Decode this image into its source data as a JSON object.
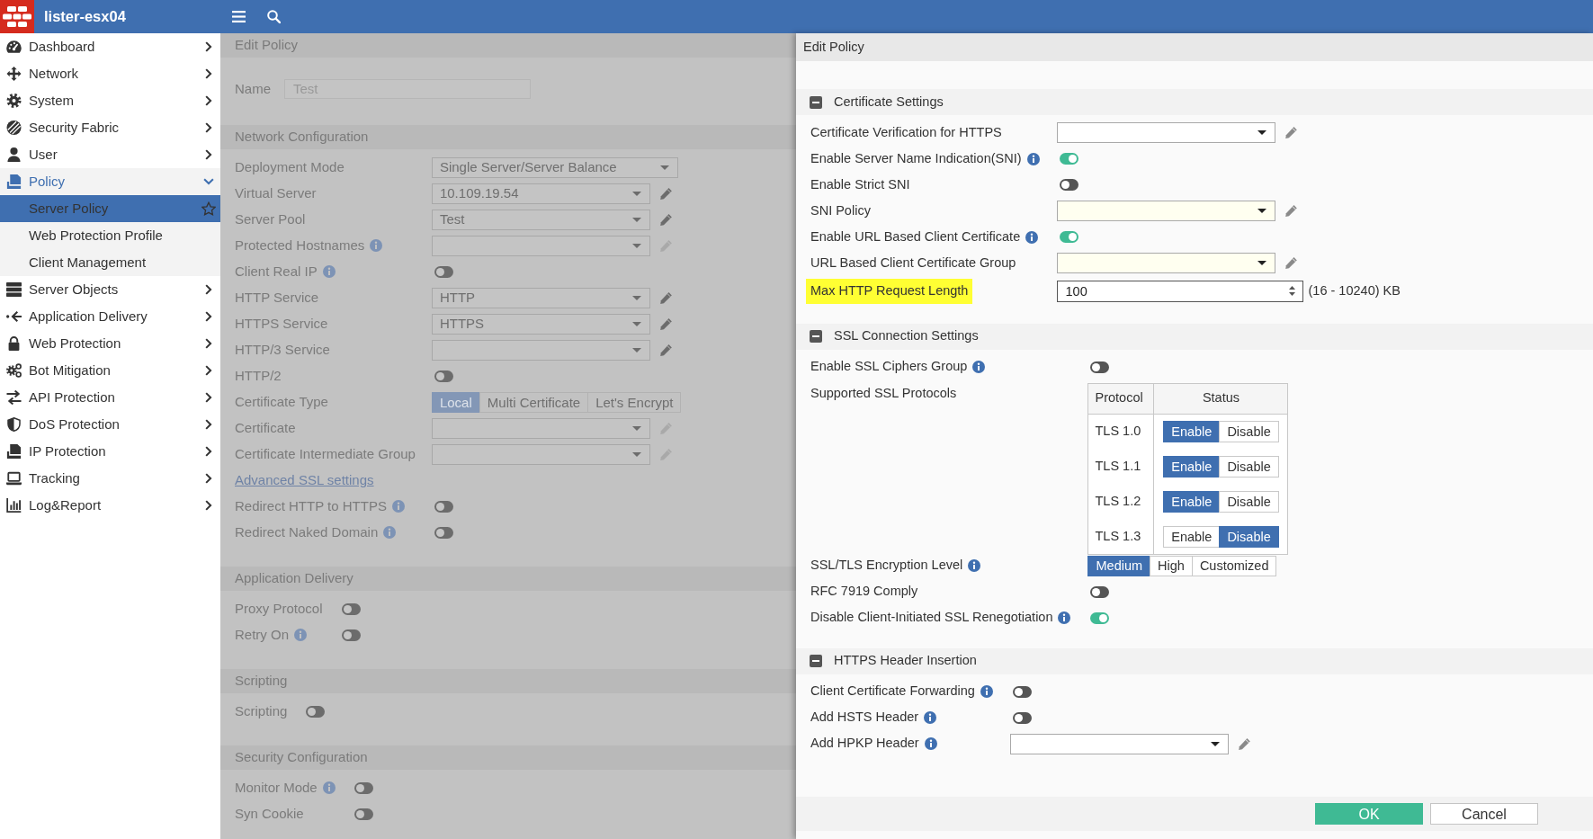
{
  "top_bar": {
    "hostname": "lister-esx04"
  },
  "sidebar": {
    "items": [
      {
        "label": "Dashboard",
        "expanded": false,
        "selected": false
      },
      {
        "label": "Network",
        "expanded": false,
        "selected": false
      },
      {
        "label": "System",
        "expanded": false,
        "selected": false
      },
      {
        "label": "Security Fabric",
        "expanded": false,
        "selected": false
      },
      {
        "label": "User",
        "expanded": false,
        "selected": false
      },
      {
        "label": "Policy",
        "expanded": true,
        "selected": false,
        "children": [
          {
            "label": "Server Policy",
            "selected": true
          },
          {
            "label": "Web Protection Profile",
            "selected": false
          },
          {
            "label": "Client Management",
            "selected": false
          }
        ]
      },
      {
        "label": "Server Objects",
        "expanded": false,
        "selected": false
      },
      {
        "label": "Application Delivery",
        "expanded": false,
        "selected": false
      },
      {
        "label": "Web Protection",
        "expanded": false,
        "selected": false
      },
      {
        "label": "Bot Mitigation",
        "expanded": false,
        "selected": false
      },
      {
        "label": "API Protection",
        "expanded": false,
        "selected": false
      },
      {
        "label": "DoS Protection",
        "expanded": false,
        "selected": false
      },
      {
        "label": "IP Protection",
        "expanded": false,
        "selected": false
      },
      {
        "label": "Tracking",
        "expanded": false,
        "selected": false
      },
      {
        "label": "Log&Report",
        "expanded": false,
        "selected": false
      }
    ]
  },
  "background_dialog": {
    "title": "Edit Policy",
    "name": {
      "label": "Name",
      "value": "Test",
      "disabled": true
    },
    "sections": [
      {
        "title": "Network Configuration",
        "rows": [
          {
            "kind": "select",
            "label": "Deployment Mode",
            "value": "Single Server/Server Balance"
          },
          {
            "kind": "select",
            "label": "Virtual Server",
            "value": "10.109.19.54",
            "edit_button": {
              "disabled": false
            }
          },
          {
            "kind": "select",
            "label": "Server Pool",
            "value": "Test",
            "edit_button": {
              "disabled": false
            }
          },
          {
            "kind": "select",
            "label": "Protected Hostnames",
            "info": true,
            "edit_button": {
              "disabled": true
            }
          },
          {
            "kind": "toggle",
            "label": "Client Real IP",
            "info": true,
            "on": false
          },
          {
            "kind": "select",
            "label": "HTTP Service",
            "value": "HTTP",
            "edit_button": {
              "disabled": false
            }
          },
          {
            "kind": "select",
            "label": "HTTPS Service",
            "value": "HTTPS",
            "edit_button": {
              "disabled": false
            }
          },
          {
            "kind": "select",
            "label": "HTTP/3 Service",
            "edit_button": {
              "disabled": false
            }
          },
          {
            "kind": "toggle",
            "label": "HTTP/2",
            "on": false
          },
          {
            "kind": "segmented",
            "label": "Certificate Type",
            "options": [
              {
                "label": "Local",
                "selected": true
              },
              {
                "label": "Multi Certificate",
                "selected": false
              },
              {
                "label": "Let's Encrypt",
                "selected": false
              }
            ]
          },
          {
            "kind": "select",
            "label": "Certificate",
            "edit_button": {
              "disabled": true
            }
          },
          {
            "kind": "select",
            "label": "Certificate Intermediate Group",
            "edit_button": {
              "disabled": true
            }
          },
          {
            "kind": "link",
            "label": "Advanced SSL settings"
          },
          {
            "kind": "toggle",
            "label": "Redirect HTTP to HTTPS",
            "info": true,
            "on": false
          },
          {
            "kind": "toggle",
            "label": "Redirect Naked Domain",
            "info": true,
            "on": false
          }
        ]
      },
      {
        "title": "Application Delivery",
        "rows": [
          {
            "kind": "toggle",
            "label": "Proxy Protocol",
            "on": false
          },
          {
            "kind": "toggle",
            "label": "Retry On",
            "info": true,
            "on": false
          }
        ]
      },
      {
        "title": "Scripting",
        "rows": [
          {
            "kind": "toggle",
            "label": "Scripting",
            "on": false
          }
        ]
      },
      {
        "title": "Security Configuration",
        "rows": [
          {
            "kind": "toggle",
            "label": "Monitor Mode",
            "info": true,
            "on": false
          },
          {
            "kind": "toggle",
            "label": "Syn Cookie",
            "on": false
          }
        ]
      }
    ]
  },
  "dialog": {
    "title": "Edit Policy",
    "sections": [
      {
        "title": "Certificate Settings",
        "expanded": true,
        "rows": [
          {
            "kind": "select",
            "label": "Certificate Verification for HTTPS",
            "edit_button": {
              "disabled": false
            }
          },
          {
            "kind": "toggle",
            "label": "Enable Server Name Indication(SNI)",
            "info": true,
            "on": true
          },
          {
            "kind": "toggle",
            "label": "Enable Strict SNI",
            "on": false
          },
          {
            "kind": "select",
            "label": "SNI Policy",
            "required": true,
            "edit_button": {
              "disabled": false
            }
          },
          {
            "kind": "toggle",
            "label": "Enable URL Based Client Certificate",
            "info": true,
            "on": true
          },
          {
            "kind": "select",
            "label": "URL Based Client Certificate Group",
            "required": true,
            "edit_button": {
              "disabled": false
            }
          },
          {
            "kind": "number",
            "label": "Max HTTP Request Length",
            "highlighted": true,
            "value": "100",
            "focused": true,
            "suffix": "(16 - 10240) KB"
          }
        ]
      },
      {
        "title": "SSL Connection Settings",
        "expanded": true,
        "rows": [
          {
            "kind": "toggle",
            "label": "Enable SSL Ciphers Group",
            "info": true,
            "on": false
          },
          {
            "kind": "protocol_table",
            "label": "Supported SSL Protocols",
            "columns": [
              "Protocol",
              "Status"
            ],
            "protocols": [
              {
                "name": "TLS 1.0",
                "options": [
                  {
                    "label": "Enable",
                    "selected": true
                  },
                  {
                    "label": "Disable",
                    "selected": false
                  }
                ]
              },
              {
                "name": "TLS 1.1",
                "options": [
                  {
                    "label": "Enable",
                    "selected": true
                  },
                  {
                    "label": "Disable",
                    "selected": false
                  }
                ]
              },
              {
                "name": "TLS 1.2",
                "options": [
                  {
                    "label": "Enable",
                    "selected": true
                  },
                  {
                    "label": "Disable",
                    "selected": false
                  }
                ]
              },
              {
                "name": "TLS 1.3",
                "options": [
                  {
                    "label": "Enable",
                    "selected": false
                  },
                  {
                    "label": "Disable",
                    "selected": true
                  }
                ]
              }
            ]
          },
          {
            "kind": "segmented",
            "label": "SSL/TLS Encryption Level",
            "info": true,
            "options": [
              {
                "label": "Medium",
                "selected": true
              },
              {
                "label": "High",
                "selected": false
              },
              {
                "label": "Customized",
                "selected": false
              }
            ]
          },
          {
            "kind": "toggle",
            "label": "RFC 7919 Comply",
            "on": false
          },
          {
            "kind": "toggle",
            "label": "Disable Client-Initiated SSL Renegotiation",
            "info": true,
            "on": true
          }
        ]
      },
      {
        "title": "HTTPS Header Insertion",
        "expanded": true,
        "rows": [
          {
            "kind": "toggle",
            "label": "Client Certificate Forwarding",
            "info": true,
            "on": false
          },
          {
            "kind": "toggle",
            "label": "Add HSTS Header",
            "info": true,
            "on": false
          },
          {
            "kind": "select",
            "label": "Add HPKP Header",
            "info": true,
            "edit_button": {
              "disabled": false
            }
          }
        ]
      }
    ],
    "buttons": [
      {
        "label": "OK",
        "kind": "primary"
      },
      {
        "label": "Cancel",
        "kind": "secondary"
      }
    ]
  }
}
